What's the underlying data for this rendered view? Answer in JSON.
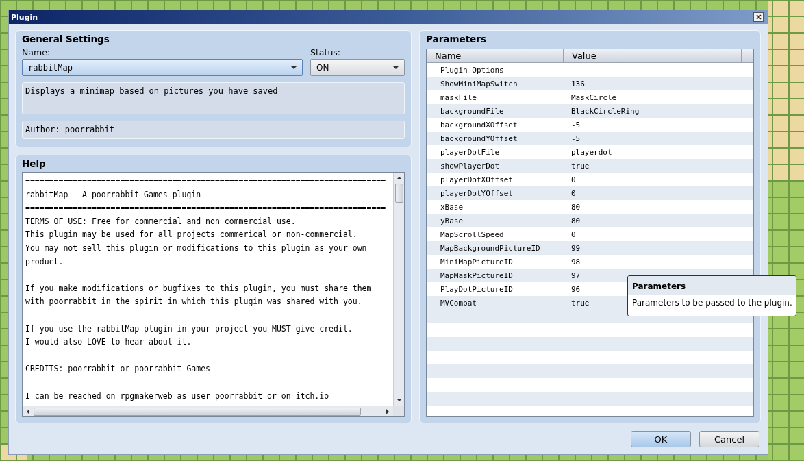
{
  "window": {
    "title": "Plugin"
  },
  "general_settings": {
    "title": "General Settings",
    "name_label": "Name:",
    "name": "rabbitMap",
    "name_focused": true,
    "status_label": "Status:",
    "status": "ON",
    "description": "Displays a minimap based on pictures you have saved",
    "author": "Author: poorrabbit"
  },
  "help": {
    "title": "Help",
    "paragraphs": [
      [
        "============================================================================",
        "rabbitMap - A poorrabbit Games plugin",
        "============================================================================",
        "TERMS OF USE: Free for commercial and non commercial use.",
        "This plugin may be used for all projects commerical or non-commercial.",
        "You may not sell this plugin or modifications to this plugin as your own",
        "product."
      ],
      [
        "If you make modifications or bugfixes to this plugin, you must share them",
        "with poorrabbit in the spirit in which this plugin was shared with you."
      ],
      [
        "If you use the rabbitMap plugin in your project you MUST give credit.",
        "I would also LOVE to hear about it."
      ],
      [
        "CREDITS: poorrabbit or poorrabbit Games"
      ],
      [
        "I can be reached on rpgmakerweb as user poorrabbit or on itch.io"
      ]
    ]
  },
  "parameters": {
    "title": "Parameters",
    "columns": [
      "Name",
      "Value"
    ],
    "rows": [
      {
        "name": "Plugin Options",
        "value": "----------------------------------------"
      },
      {
        "name": "ShowMiniMapSwitch",
        "value": "136"
      },
      {
        "name": "maskFile",
        "value": "MaskCircle"
      },
      {
        "name": "backgroundFile",
        "value": "BlackCircleRing"
      },
      {
        "name": "backgroundXOffset",
        "value": "-5"
      },
      {
        "name": "backgroundYOffset",
        "value": "-5"
      },
      {
        "name": "playerDotFile",
        "value": "playerdot"
      },
      {
        "name": "showPlayerDot",
        "value": "true"
      },
      {
        "name": "playerDotXOffset",
        "value": "0"
      },
      {
        "name": "playerDotYOffset",
        "value": "0"
      },
      {
        "name": "xBase",
        "value": "80"
      },
      {
        "name": "yBase",
        "value": "80"
      },
      {
        "name": "MapScrollSpeed",
        "value": "0"
      },
      {
        "name": "MapBackgroundPictureID",
        "value": "99"
      },
      {
        "name": "MiniMapPictureID",
        "value": "98"
      },
      {
        "name": "MapMaskPictureID",
        "value": "97"
      },
      {
        "name": "PlayDotPictureID",
        "value": "96"
      },
      {
        "name": "MVCompat",
        "value": "true"
      }
    ]
  },
  "tooltip": {
    "title": "Parameters",
    "text": "Parameters to be passed to the plugin."
  },
  "buttons": [
    {
      "label": "OK",
      "default": true
    },
    {
      "label": "Cancel",
      "default": false
    }
  ]
}
